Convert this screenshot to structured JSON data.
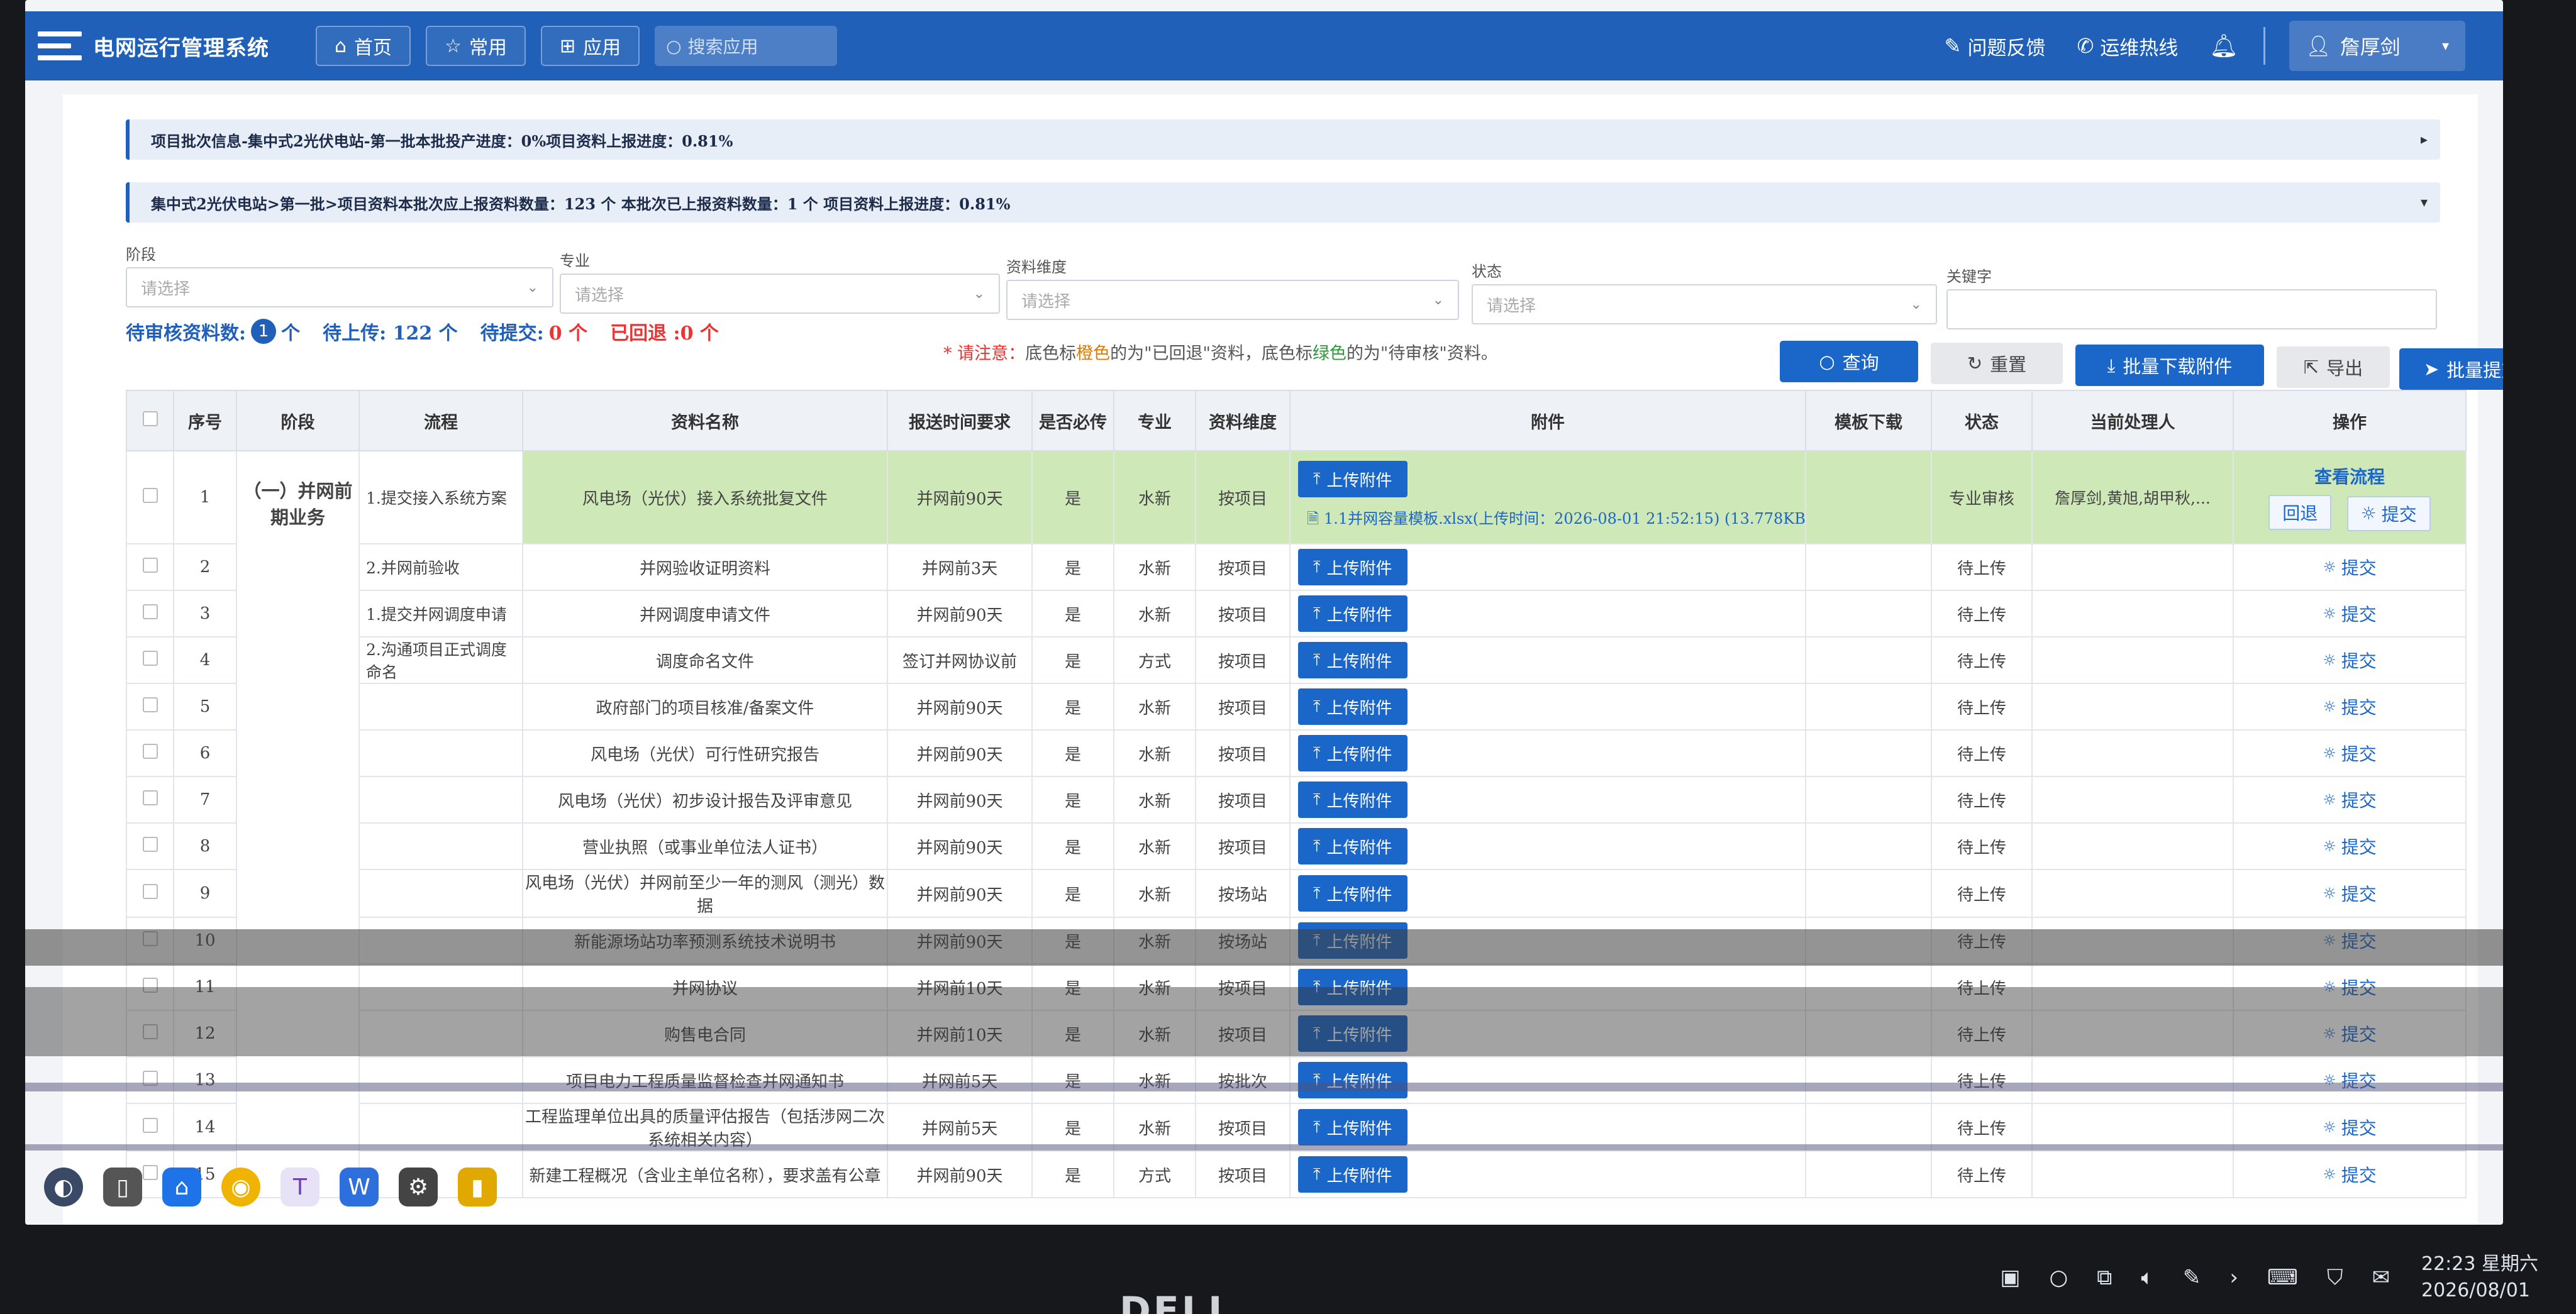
{
  "app": {
    "title": "电网运行管理系统"
  },
  "header": {
    "nav": [
      "首页",
      "常用",
      "应用"
    ],
    "search_placeholder": "搜索应用",
    "feedback": "问题反馈",
    "hotline": "运维热线",
    "user": "詹厚剑"
  },
  "info": {
    "bar1": "项目批次信息-集中式2光伏电站-第一批本批投产进度：0%项目资料上报进度：0.81%",
    "bar2": "集中式2光伏电站>第一批>项目资料本批次应上报资料数量：123 个 本批次已上报资料数量：1 个 项目资料上报进度：0.81%"
  },
  "filters": {
    "stage_label": "阶段",
    "major_label": "专业",
    "dimension_label": "资料维度",
    "status_label": "状态",
    "keyword_label": "关键字",
    "placeholder": "请选择"
  },
  "stats": {
    "pending_review_label": "待审核资料数:",
    "pending_review_count": "1",
    "unit": "个",
    "pending_upload": "待上传: 122 个",
    "pending_submit_label": "待提交:",
    "pending_submit_value": "0 个",
    "returned": "已回退 :0 个"
  },
  "notice": {
    "star": "* 请注意：",
    "p1": "底色标",
    "orange": "橙色",
    "p2": "的为\"已回退\"资料，底色标",
    "green": "绿色",
    "p3": "的为\"待审核\"资料。"
  },
  "actions": {
    "query": "查询",
    "reset": "重置",
    "batch_download": "批量下载附件",
    "export": "导出",
    "batch_submit": "批量提交"
  },
  "table": {
    "headers": [
      "序号",
      "阶段",
      "流程",
      "资料名称",
      "报送时间要求",
      "是否必传",
      "专业",
      "资料维度",
      "附件",
      "模板下载",
      "状态",
      "当前处理人",
      "操作"
    ],
    "stage": "（一）并网前期业务",
    "upload_label": "上传附件",
    "submit_label": "提交",
    "view_flow": "查看流程",
    "rollback": "回退",
    "file_name": "1.1并网容量模板.xlsx(上传时间：2026-08-01 21:52:15) (13.778KB)",
    "rows": [
      {
        "no": "1",
        "flow": "1.提交接入系统方案",
        "name": "风电场（光伏）接入系统批复文件",
        "time": "并网前90天",
        "req": "是",
        "major": "水新",
        "dim": "按项目",
        "status": "专业审核",
        "handler": "詹厚剑,黄旭,胡甲秋,..."
      },
      {
        "no": "2",
        "flow": "2.并网前验收",
        "name": "并网验收证明资料",
        "time": "并网前3天",
        "req": "是",
        "major": "水新",
        "dim": "按项目",
        "status": "待上传",
        "handler": ""
      },
      {
        "no": "3",
        "flow": "1.提交并网调度申请",
        "name": "并网调度申请文件",
        "time": "并网前90天",
        "req": "是",
        "major": "水新",
        "dim": "按项目",
        "status": "待上传",
        "handler": ""
      },
      {
        "no": "4",
        "flow": "2.沟通项目正式调度命名",
        "name": "调度命名文件",
        "time": "签订并网协议前",
        "req": "是",
        "major": "方式",
        "dim": "按项目",
        "status": "待上传",
        "handler": ""
      },
      {
        "no": "5",
        "flow": "",
        "name": "政府部门的项目核准/备案文件",
        "time": "并网前90天",
        "req": "是",
        "major": "水新",
        "dim": "按项目",
        "status": "待上传",
        "handler": ""
      },
      {
        "no": "6",
        "flow": "",
        "name": "风电场（光伏）可行性研究报告",
        "time": "并网前90天",
        "req": "是",
        "major": "水新",
        "dim": "按项目",
        "status": "待上传",
        "handler": ""
      },
      {
        "no": "7",
        "flow": "",
        "name": "风电场（光伏）初步设计报告及评审意见",
        "time": "并网前90天",
        "req": "是",
        "major": "水新",
        "dim": "按项目",
        "status": "待上传",
        "handler": ""
      },
      {
        "no": "8",
        "flow": "",
        "name": "营业执照（或事业单位法人证书）",
        "time": "并网前90天",
        "req": "是",
        "major": "水新",
        "dim": "按项目",
        "status": "待上传",
        "handler": ""
      },
      {
        "no": "9",
        "flow": "",
        "name": "风电场（光伏）并网前至少一年的测风（测光）数据",
        "time": "并网前90天",
        "req": "是",
        "major": "水新",
        "dim": "按场站",
        "status": "待上传",
        "handler": ""
      },
      {
        "no": "10",
        "flow": "",
        "name": "新能源场站功率预测系统技术说明书",
        "time": "并网前90天",
        "req": "是",
        "major": "水新",
        "dim": "按场站",
        "status": "待上传",
        "handler": ""
      },
      {
        "no": "11",
        "flow": "",
        "name": "并网协议",
        "time": "并网前10天",
        "req": "是",
        "major": "水新",
        "dim": "按项目",
        "status": "待上传",
        "handler": ""
      },
      {
        "no": "12",
        "flow": "",
        "name": "购售电合同",
        "time": "并网前10天",
        "req": "是",
        "major": "水新",
        "dim": "按项目",
        "status": "待上传",
        "handler": ""
      },
      {
        "no": "13",
        "flow": "",
        "name": "项目电力工程质量监督检查并网通知书",
        "time": "并网前5天",
        "req": "是",
        "major": "水新",
        "dim": "按批次",
        "status": "待上传",
        "handler": ""
      },
      {
        "no": "14",
        "flow": "",
        "name": "工程监理单位出具的质量评估报告（包括涉网二次系统相关内容）",
        "time": "并网前5天",
        "req": "是",
        "major": "水新",
        "dim": "按项目",
        "status": "待上传",
        "handler": ""
      },
      {
        "no": "15",
        "flow": "",
        "name": "新建工程概况（含业主单位名称），要求盖有公章",
        "time": "并网前90天",
        "req": "是",
        "major": "方式",
        "dim": "按项目",
        "status": "待上传",
        "handler": ""
      }
    ]
  },
  "tray": {
    "time": "22:23 星期六",
    "date": "2026/08/01"
  },
  "brand": "DELL"
}
